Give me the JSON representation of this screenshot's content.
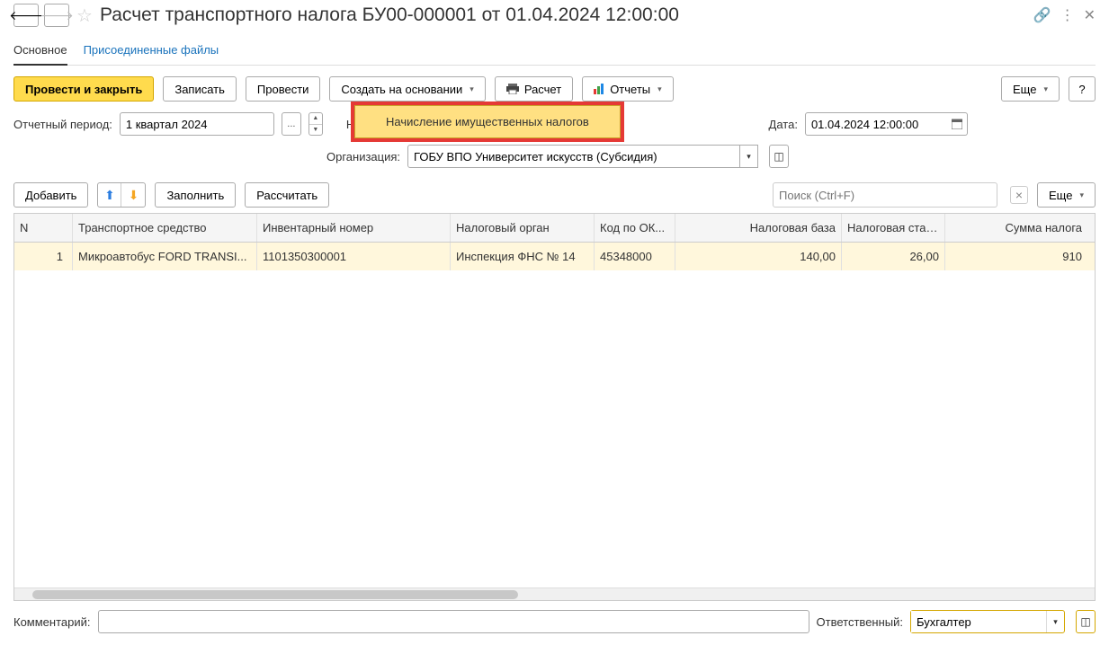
{
  "title": "Расчет транспортного налога БУ00-000001 от 01.04.2024 12:00:00",
  "tabs": {
    "main": "Основное",
    "files": "Присоединенные файлы"
  },
  "toolbar": {
    "post_close": "Провести и закрыть",
    "save": "Записать",
    "post": "Провести",
    "create_based": "Создать на основании",
    "calc": "Расчет",
    "reports": "Отчеты",
    "more": "Еще",
    "help": "?"
  },
  "dropdown": {
    "item1": "Начисление имущественных налогов"
  },
  "form": {
    "period_label": "Отчетный период:",
    "period": "1 квартал 2024",
    "number_label": "Номер:",
    "number": "",
    "date_label": "Дата:",
    "date": "01.04.2024 12:00:00",
    "org_label": "Организация:",
    "org": "ГОБУ ВПО Университет искусств (Субсидия)"
  },
  "tbl_toolbar": {
    "add": "Добавить",
    "fill": "Заполнить",
    "recalc": "Рассчитать",
    "search_ph": "Поиск (Ctrl+F)",
    "more": "Еще"
  },
  "grid": {
    "headers": {
      "n": "N",
      "vehicle": "Транспортное средство",
      "inv": "Инвентарный номер",
      "tax_auth": "Налоговый орган",
      "oktmo": "Код по ОК...",
      "base": "Налоговая база",
      "rate": "Налоговая ставка",
      "sum": "Сумма налога"
    },
    "rows": [
      {
        "n": "1",
        "vehicle": "Микроавтобус FORD TRANSI...",
        "inv": "1101350300001",
        "tax_auth": "Инспекция ФНС № 14",
        "oktmo": "45348000",
        "base": "140,00",
        "rate": "26,00",
        "sum": "910"
      }
    ]
  },
  "footer": {
    "comment_label": "Комментарий:",
    "comment": "",
    "resp_label": "Ответственный:",
    "resp": "Бухгалтер"
  }
}
